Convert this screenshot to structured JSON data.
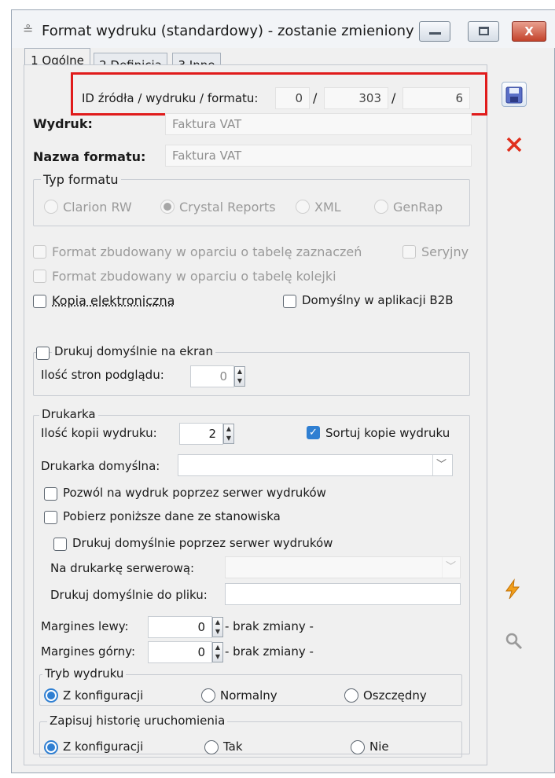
{
  "window": {
    "title": "Format wydruku (standardowy) - zostanie zmieniony",
    "buttons": {
      "minimize": "–",
      "maximize": "□",
      "close": "X"
    }
  },
  "tabs": [
    "1 Ogólne",
    "2 Definicja",
    "3 Inne"
  ],
  "id_row": {
    "label": "ID źródła / wydruku / formatu:",
    "source": "0",
    "print": "303",
    "format": "6",
    "sep": "/"
  },
  "wydruk": {
    "label": "Wydruk:",
    "value": "Faktura VAT"
  },
  "nazwa_formatu": {
    "label": "Nazwa formatu:",
    "value": "Faktura VAT"
  },
  "typ_formatu": {
    "title": "Typ formatu",
    "options": [
      "Clarion RW",
      "Crystal Reports",
      "XML",
      "GenRap"
    ],
    "selected": "Crystal Reports"
  },
  "checks": {
    "format_zaznaczen": "Format zbudowany w oparciu o tabelę zaznaczeń",
    "seryjny": "Seryjny",
    "format_kolejki": "Format zbudowany w oparciu o tabelę kolejki",
    "kopia_elektroniczna": "Kopia elektroniczna",
    "domyslny_b2b": "Domyślny w aplikacji B2B"
  },
  "podglad": {
    "title": "Drukuj domyślnie na ekran",
    "pages_label": "Ilość stron podglądu:",
    "pages_value": "0"
  },
  "drukarka": {
    "title": "Drukarka",
    "copies_label": "Ilość kopii wydruku:",
    "copies_value": "2",
    "sort_label": "Sortuj kopie wydruku",
    "default_label": "Drukarka domyślna:",
    "default_value": "",
    "server_allow": "Pozwól na wydruk poprzez serwer wydruków",
    "fetch_data": "Pobierz poniższe dane ze stanowiska",
    "server_default": "Drukuj domyślnie poprzez serwer wydruków",
    "server_printer_label": "Na drukarkę serwerową:",
    "server_printer_value": "",
    "file_label": "Drukuj domyślnie do pliku:",
    "file_value": "",
    "margin_left_label": "Margines lewy:",
    "margin_left_value": "0",
    "margin_top_label": "Margines górny:",
    "margin_top_value": "0",
    "no_change": "- brak zmiany -"
  },
  "tryb_wydruku": {
    "title": "Tryb wydruku",
    "options": [
      "Z konfiguracji",
      "Normalny",
      "Oszczędny"
    ],
    "selected": "Z konfiguracji"
  },
  "historia": {
    "title": "Zapisuj historię uruchomienia",
    "options": [
      "Z konfiguracji",
      "Tak",
      "Nie"
    ],
    "selected": "Z konfiguracji"
  },
  "side_buttons": [
    "save-icon",
    "cancel-icon",
    "lightning-icon",
    "search-icon"
  ],
  "colors": {
    "accent": "#2f7fd2",
    "highlight": "#e01b1b",
    "cancel": "#e0301e"
  }
}
